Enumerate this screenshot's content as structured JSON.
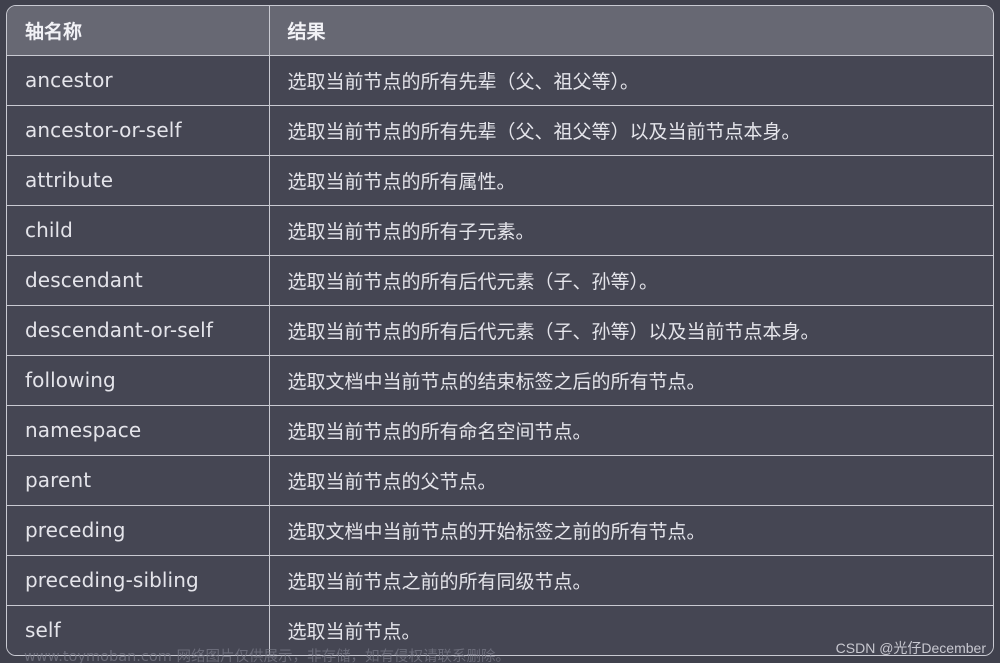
{
  "table": {
    "headers": {
      "axis": "轴名称",
      "result": "结果"
    },
    "rows": [
      {
        "axis": "ancestor",
        "result": "选取当前节点的所有先辈（父、祖父等）。"
      },
      {
        "axis": "ancestor-or-self",
        "result": "选取当前节点的所有先辈（父、祖父等）以及当前节点本身。"
      },
      {
        "axis": "attribute",
        "result": "选取当前节点的所有属性。"
      },
      {
        "axis": "child",
        "result": "选取当前节点的所有子元素。"
      },
      {
        "axis": "descendant",
        "result": "选取当前节点的所有后代元素（子、孙等）。"
      },
      {
        "axis": "descendant-or-self",
        "result": "选取当前节点的所有后代元素（子、孙等）以及当前节点本身。"
      },
      {
        "axis": "following",
        "result": "选取文档中当前节点的结束标签之后的所有节点。"
      },
      {
        "axis": "namespace",
        "result": "选取当前节点的所有命名空间节点。"
      },
      {
        "axis": "parent",
        "result": "选取当前节点的父节点。"
      },
      {
        "axis": "preceding",
        "result": "选取文档中当前节点的开始标签之前的所有节点。"
      },
      {
        "axis": "preceding-sibling",
        "result": "选取当前节点之前的所有同级节点。"
      },
      {
        "axis": "self",
        "result": "选取当前节点。"
      }
    ]
  },
  "watermark": "www.toymoban.com 网络图片仅供展示，非存储，如有侵权请联系删除。",
  "credit": "CSDN @光仔December",
  "colors": {
    "background": "#40414d",
    "header_bg": "#676873",
    "row_bg": "#454653",
    "border": "#c9cad2",
    "text": "#e4e4ea"
  }
}
